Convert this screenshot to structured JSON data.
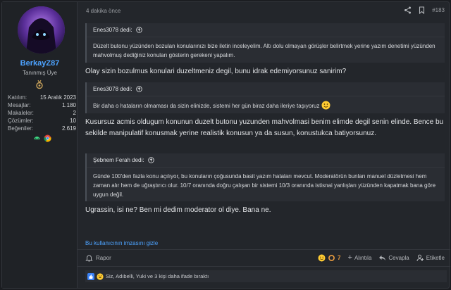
{
  "user": {
    "username": "BerkayZ87",
    "title": "Tanınmış Üye",
    "stats": [
      {
        "label": "Katılım:",
        "value": "15 Aralık 2023"
      },
      {
        "label": "Mesajlar:",
        "value": "1.180"
      },
      {
        "label": "Makaleler:",
        "value": "2"
      },
      {
        "label": "Çözümler:",
        "value": "10"
      },
      {
        "label": "Beğeniler:",
        "value": "2.619"
      }
    ],
    "icons": [
      "trophy-icon",
      "android-icon",
      "chrome-icon"
    ]
  },
  "post": {
    "time": "4 dakika önce",
    "number": "#183",
    "quotes": [
      {
        "author": "Enes3078 dedi:",
        "body": "Düzelt butonu yüzünden bozulan konularınızı bize iletin inceleyelim. Altı dolu olmayan görüşler belirtmek yerine yazım denetimi yüzünden mahvolmuş dediğiniz konuları gösterin gerekeni yapalım."
      },
      {
        "author": "Enes3078 dedi:",
        "body": "Bir daha o hataların olmaması da sizin elinizde, sistemi her gün biraz daha ileriye taşıyoruz"
      },
      {
        "author": "Şebnem Ferah dedi:",
        "body": "Günde 100'den fazla konu açılıyor, bu konuların çoğusunda basit yazım hataları mevcut. Moderatörün bunları manuel düzletmesi hem zaman alır hem de uğraştırıcı olur. 10/7 oranında doğru çalışan bir sistemi 10/3 oranında istisnai yanlışları yüzünden kapatmak bana göre uygun değil."
      }
    ],
    "replies": [
      "Olay sizin bozulmus konulari duzeltmeniz degil, bunu idrak edemiyorsunuz sanirim?",
      "Kusursuz acmis oldugum konunun duzelt butonu yuzunden mahvolmasi benim elimde degil senin elinde. Bence bu sekilde manipulatif konusmak yerine realistik konusun ya da susun, konustukca batiyorsunuz.",
      "Ugrassin, isi ne? Ben mi dedim moderator ol diye. Bana ne."
    ],
    "signature_toggle": "Bu kullanıcının imzasını gizle",
    "actions": {
      "report": "Rapor",
      "reaction_count": "7",
      "quote": "Alıntıla",
      "reply": "Cevapla",
      "tag": "Etiketle"
    },
    "reactions_text": "Siz, Adıbelli, Yuki ve 3 kişi daha ifade bıraktı"
  },
  "colors": {
    "accent": "#4da3ff",
    "background": "#23262b",
    "quote_bg": "#2a2d33"
  }
}
